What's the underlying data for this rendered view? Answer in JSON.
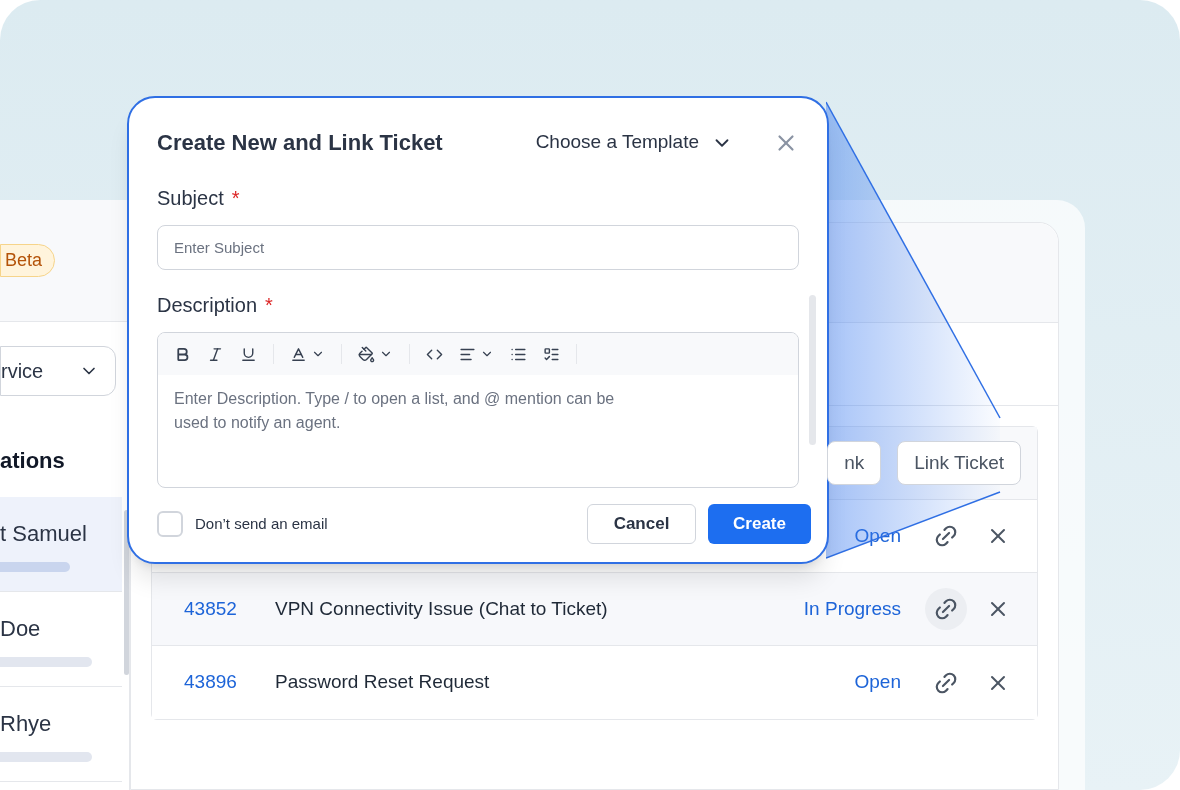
{
  "sidebar": {
    "badge": "Beta",
    "dropdown": "rvice",
    "heading": "ations",
    "items": [
      {
        "name": "t Samuel",
        "selected": true
      },
      {
        "name": "Doe",
        "selected": false
      },
      {
        "name": "Rhye",
        "selected": false
      }
    ]
  },
  "table": {
    "buttons": [
      "nk",
      "Link Ticket"
    ],
    "rows": [
      {
        "status": "Open",
        "link_hovered": false
      },
      {
        "id": "43852",
        "subject": "VPN Connectivity Issue (Chat to Ticket)",
        "status": "In Progress",
        "link_hovered": true
      },
      {
        "id": "43896",
        "subject": "Password Reset Request",
        "status": "Open",
        "link_hovered": false
      }
    ]
  },
  "dialog": {
    "title": "Create New and Link Ticket",
    "template": "Choose a Template",
    "subject": {
      "label": "Subject",
      "required": "*",
      "placeholder": "Enter Subject"
    },
    "description": {
      "label": "Description",
      "required": "*",
      "placeholder": "Enter Description. Type / to open a list, and @ mention can be used to notify an agent."
    },
    "checkbox": {
      "label": "Don’t send an email",
      "checked": false
    },
    "buttons": [
      {
        "label": "Cancel",
        "kind": "secondary"
      },
      {
        "label": "Create",
        "kind": "primary"
      }
    ]
  }
}
